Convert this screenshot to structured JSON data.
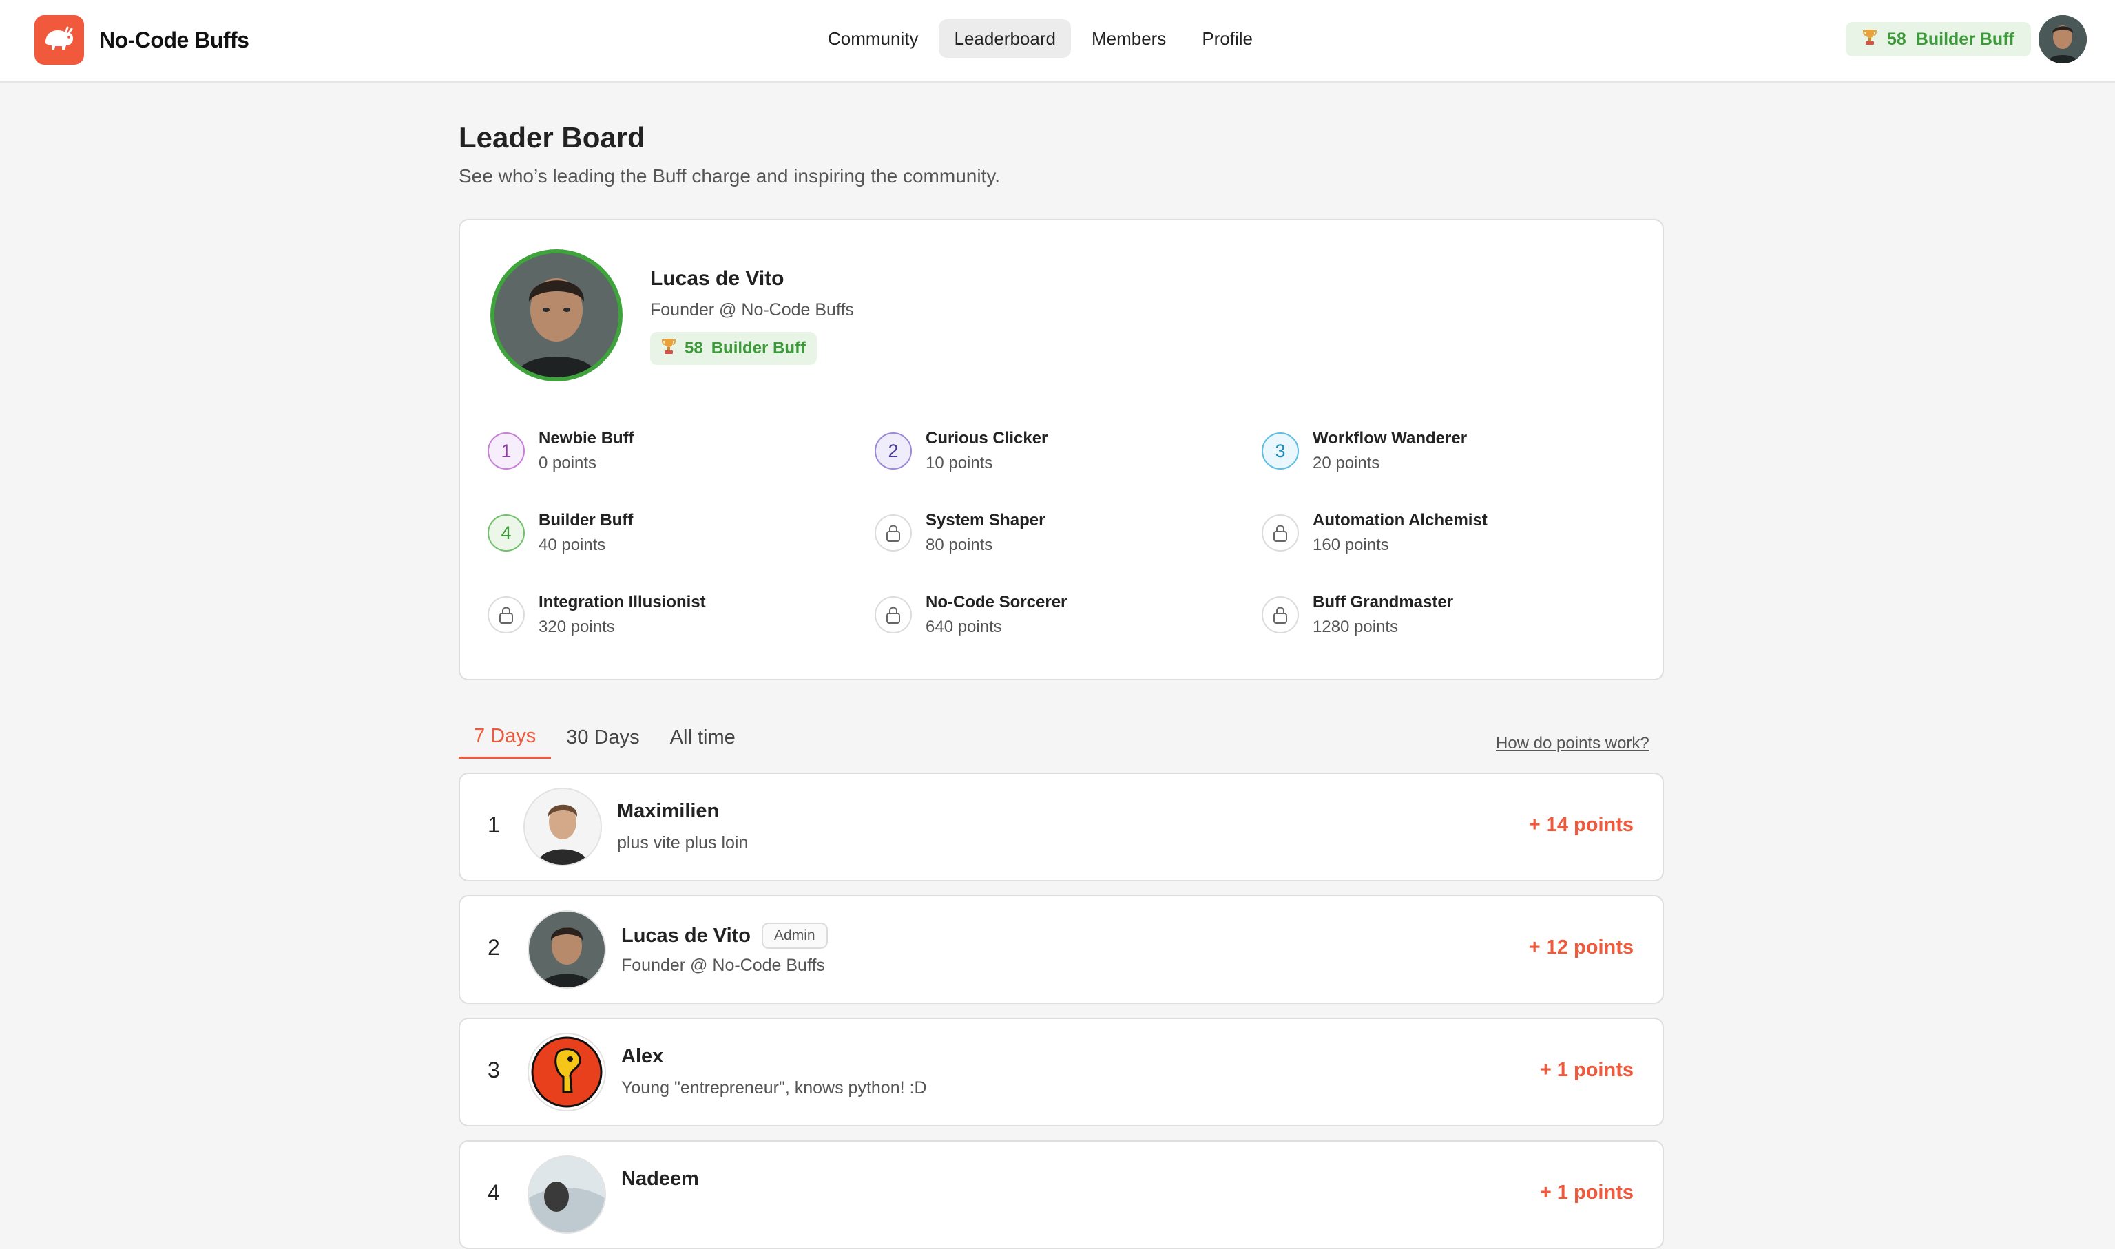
{
  "header": {
    "brand_name": "No-Code Buffs",
    "nav": [
      "Community",
      "Leaderboard",
      "Members",
      "Profile"
    ],
    "active_nav": "Leaderboard",
    "badge_points": "58",
    "badge_title": "Builder Buff"
  },
  "page": {
    "title": "Leader Board",
    "subtitle": "See who’s leading the Buff charge and inspiring the community."
  },
  "profile": {
    "name": "Lucas de Vito",
    "role": "Founder @ No-Code Buffs",
    "badge_points": "58",
    "badge_title": "Builder Buff"
  },
  "levels": [
    {
      "icon": "1",
      "name": "Newbie Buff",
      "points": "0 points",
      "state": "unlocked"
    },
    {
      "icon": "2",
      "name": "Curious Clicker",
      "points": "10 points",
      "state": "unlocked"
    },
    {
      "icon": "3",
      "name": "Workflow Wanderer",
      "points": "20 points",
      "state": "unlocked"
    },
    {
      "icon": "4",
      "name": "Builder Buff",
      "points": "40 points",
      "state": "unlocked"
    },
    {
      "icon": "lock-icon",
      "name": "System Shaper",
      "points": "80 points",
      "state": "locked"
    },
    {
      "icon": "lock-icon",
      "name": "Automation Alchemist",
      "points": "160 points",
      "state": "locked"
    },
    {
      "icon": "lock-icon",
      "name": "Integration Illusionist",
      "points": "320 points",
      "state": "locked"
    },
    {
      "icon": "lock-icon",
      "name": "No-Code Sorcerer",
      "points": "640 points",
      "state": "locked"
    },
    {
      "icon": "lock-icon",
      "name": "Buff Grandmaster",
      "points": "1280 points",
      "state": "locked"
    }
  ],
  "tabs": [
    "7 Days",
    "30 Days",
    "All time"
  ],
  "active_tab": "7 Days",
  "how_link": "How do points work?",
  "leaderboard": [
    {
      "rank": "1",
      "name": "Maximilien",
      "bio": "plus vite plus loin",
      "points": "+ 14 points",
      "admin": ""
    },
    {
      "rank": "2",
      "name": "Lucas de Vito",
      "bio": "Founder @ No-Code Buffs",
      "points": "+ 12 points",
      "admin": "Admin"
    },
    {
      "rank": "3",
      "name": "Alex",
      "bio": "Young \"entrepreneur\", knows python! :D",
      "points": "+ 1 points",
      "admin": ""
    },
    {
      "rank": "4",
      "name": "Nadeem",
      "bio": "",
      "points": "+ 1 points",
      "admin": ""
    }
  ],
  "colors": {
    "accent": "#f0593c",
    "badge_green": "#3d9a3a",
    "badge_bg": "#e8f5e6"
  }
}
